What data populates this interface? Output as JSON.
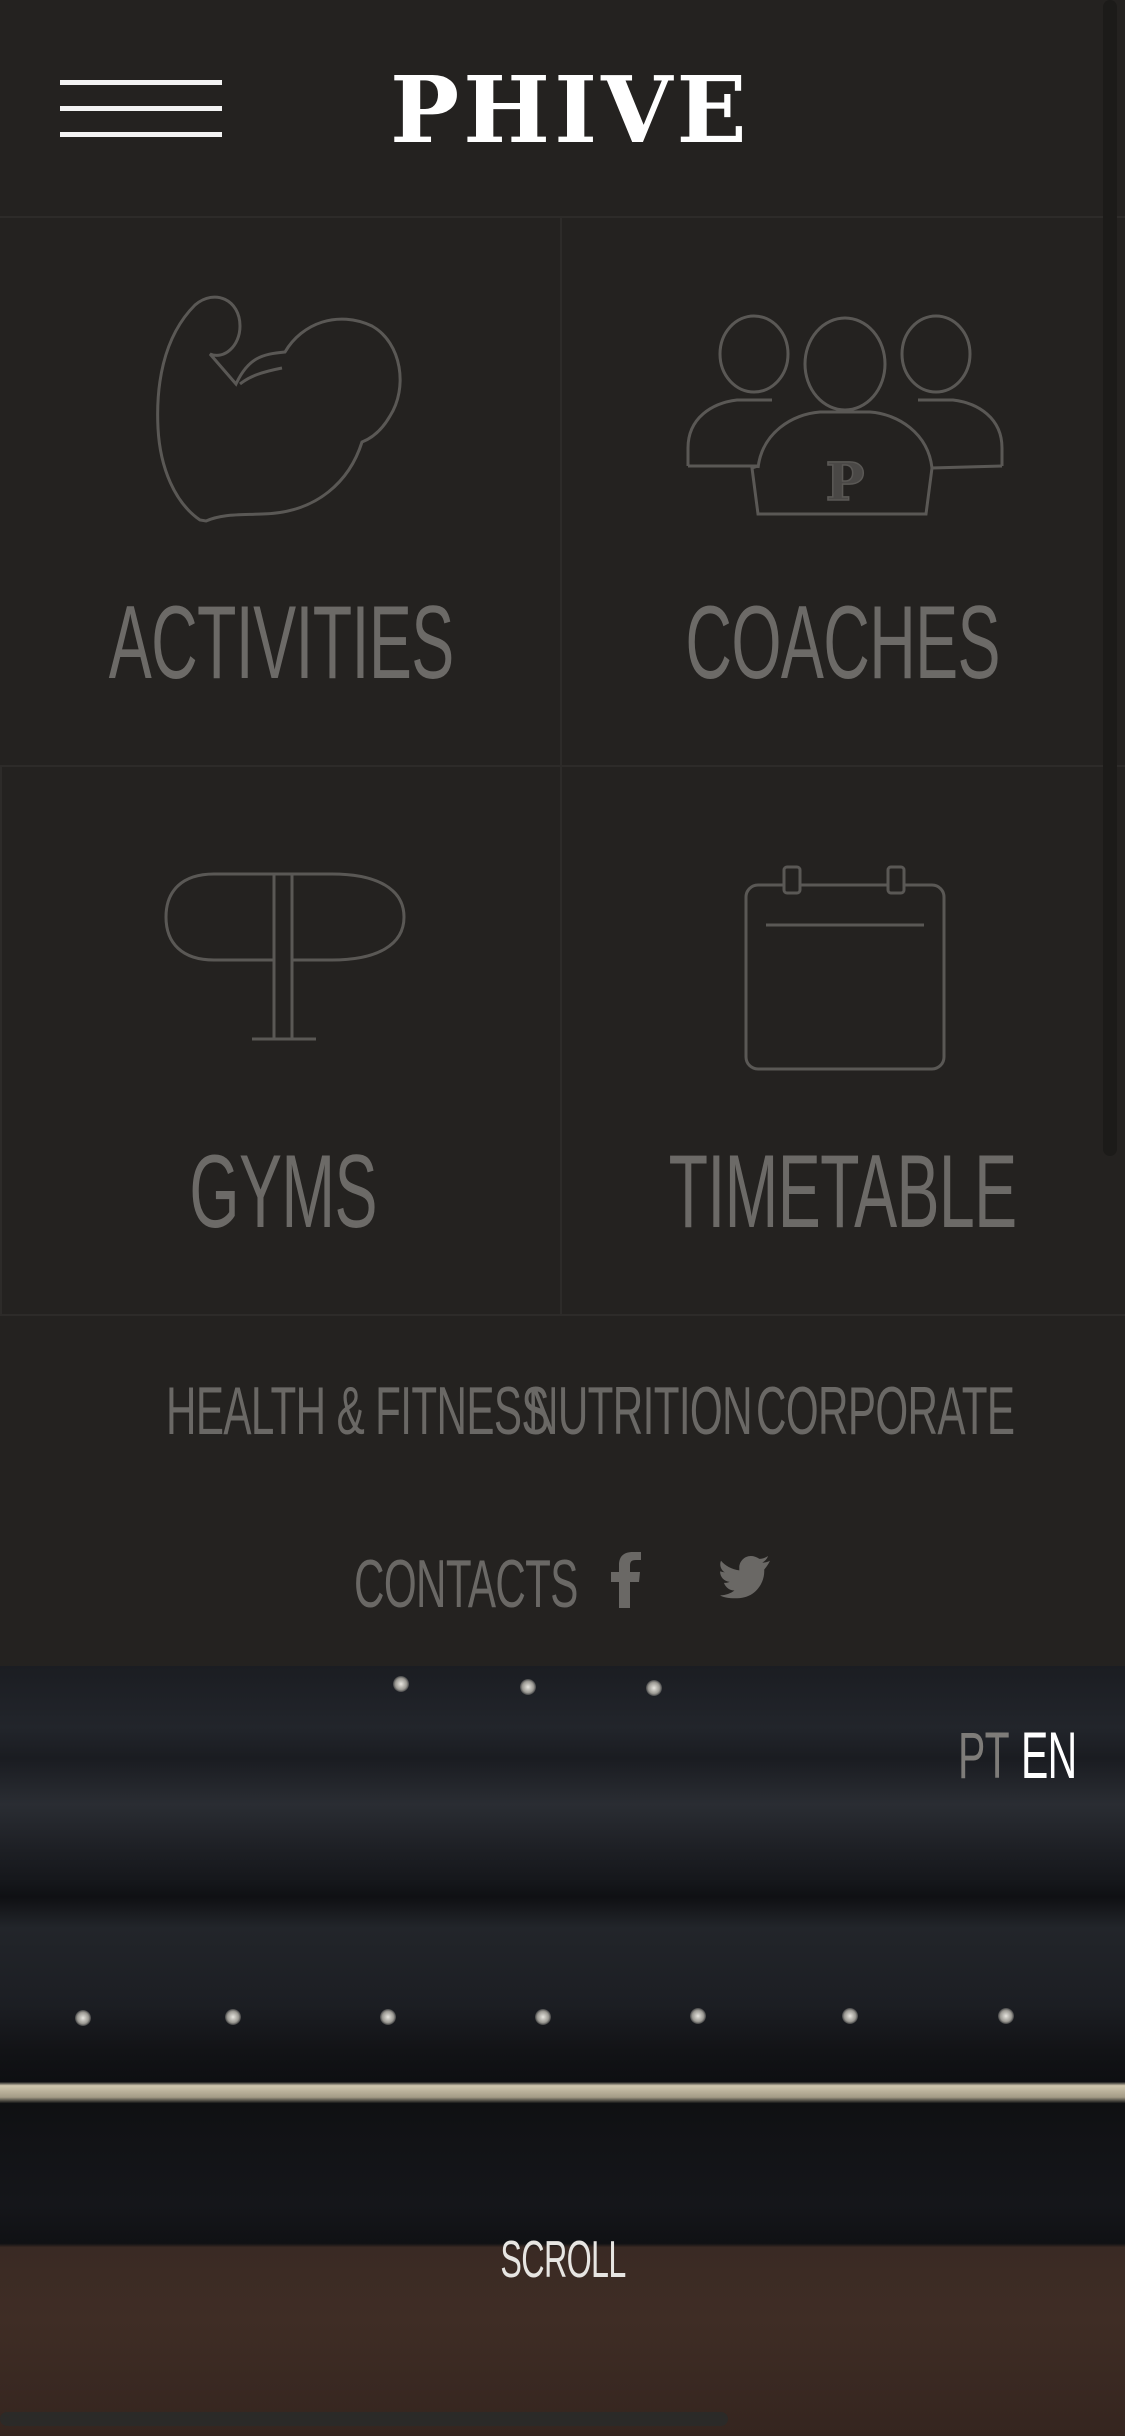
{
  "header": {
    "menu_icon": "hamburger-icon",
    "logo_text": "PHIVE"
  },
  "tiles": [
    {
      "label": "ACTIVITIES",
      "icon": "flexed-arm-icon"
    },
    {
      "label": "COACHES",
      "icon": "group-people-icon"
    },
    {
      "label": "GYMS",
      "icon": "gym-logo-icon"
    },
    {
      "label": "TIMETABLE",
      "icon": "calendar-icon"
    }
  ],
  "coaches_badge_letter": "P",
  "links": {
    "health": "HEALTH & FITNESS",
    "nutrition": "NUTRITION",
    "corporate": "CORPORATE",
    "contacts": "CONTACTS",
    "facebook_icon": "facebook-icon",
    "twitter_icon": "twitter-icon"
  },
  "language": {
    "pt": "PT",
    "en": "EN",
    "active": "EN"
  },
  "hero": {
    "scroll_label": "SCROLL"
  },
  "colors": {
    "background": "#242220",
    "muted_text": "#6c6a67",
    "white": "#ffffff"
  }
}
